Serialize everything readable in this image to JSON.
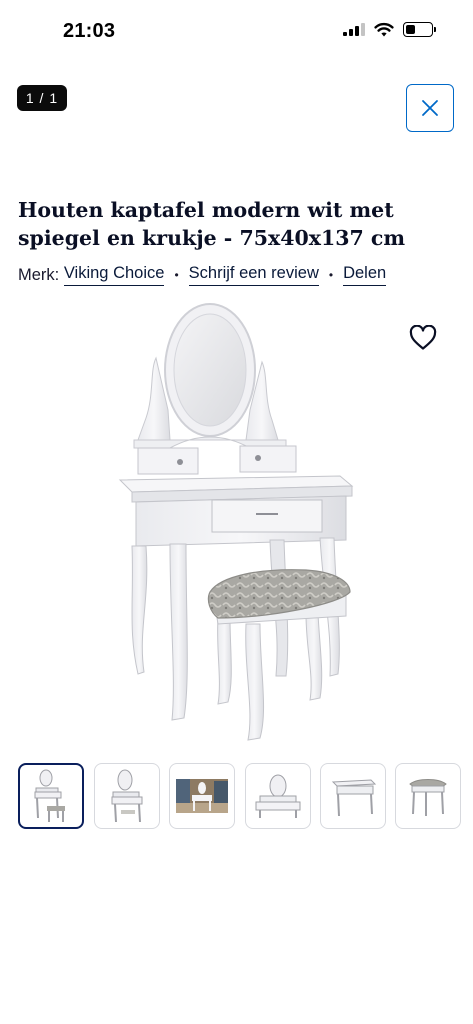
{
  "status_bar": {
    "time": "21:03"
  },
  "gallery": {
    "counter": "1 / 1",
    "close_icon": "close-icon",
    "thumbnails": [
      {
        "icon": "vanity-with-stool-thumbnail",
        "active": true
      },
      {
        "icon": "vanity-mirror-thumbnail",
        "active": false
      },
      {
        "icon": "vanity-room-scene-thumbnail",
        "active": false
      },
      {
        "icon": "vanity-top-detail-thumbnail",
        "active": false
      },
      {
        "icon": "table-only-thumbnail",
        "active": false
      },
      {
        "icon": "stool-thumbnail",
        "active": false
      }
    ]
  },
  "product": {
    "title": "Houten kaptafel modern wit met spiegel en krukje - 75x40x137 cm",
    "brand_prefix": "Merk: ",
    "brand": "Viking Choice",
    "review_link": "Schrijf een review",
    "share_link": "Delen",
    "separator": "•",
    "wishlist_icon": "heart-icon"
  },
  "colors": {
    "accent_blue": "#0069c8",
    "navy_text": "#0a0f24",
    "active_thumb_border": "#0a1f5c"
  }
}
